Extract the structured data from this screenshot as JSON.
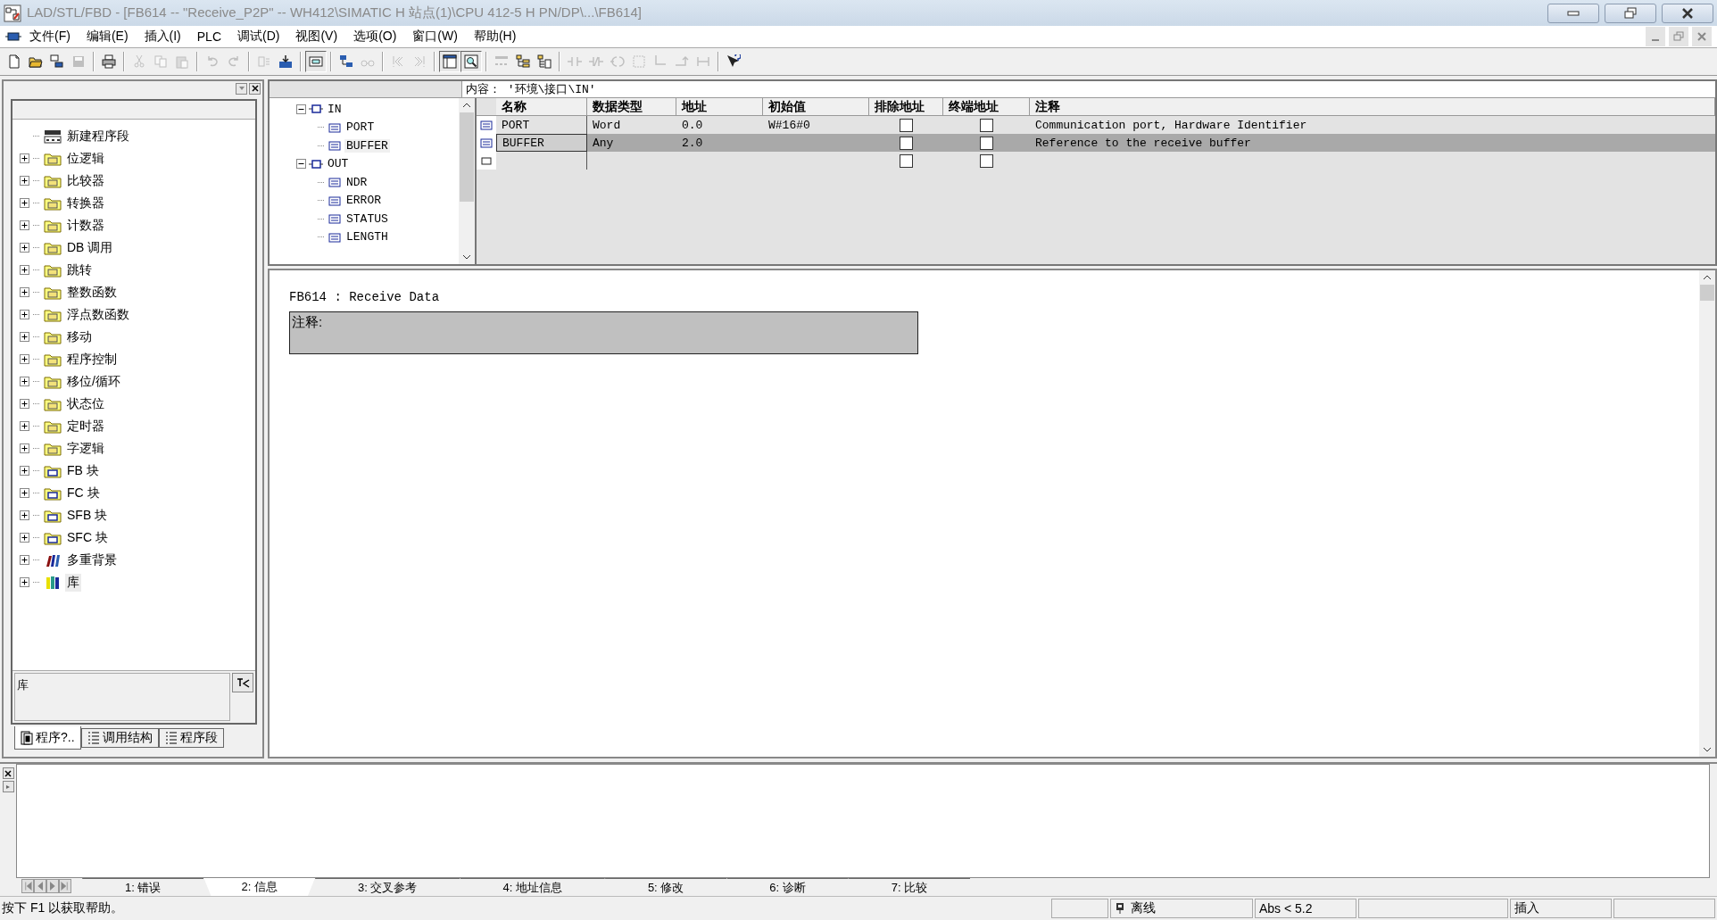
{
  "window": {
    "title": "LAD/STL/FBD  - [FB614 -- \"Receive_P2P\" -- WH412\\SIMATIC H 站点(1)\\CPU 412-5 H PN/DP\\...\\FB614]",
    "active": false
  },
  "menu": [
    "文件(F)",
    "编辑(E)",
    "插入(I)",
    "PLC",
    "调试(D)",
    "视图(V)",
    "选项(O)",
    "窗口(W)",
    "帮助(H)"
  ],
  "toolbar": [
    [
      {
        "pressed": false,
        "disabled": false
      },
      {
        "pressed": false,
        "disabled": false
      },
      {
        "pressed": false,
        "disabled": false
      },
      {
        "pressed": false,
        "disabled": true
      }
    ],
    [
      {
        "pressed": false,
        "disabled": false
      }
    ],
    [
      {
        "pressed": false,
        "disabled": true
      },
      {
        "pressed": false,
        "disabled": true
      },
      {
        "pressed": false,
        "disabled": true
      }
    ],
    [
      {
        "pressed": false,
        "disabled": true
      },
      {
        "pressed": false,
        "disabled": true
      }
    ],
    [
      {
        "pressed": false,
        "disabled": true
      },
      {
        "pressed": false,
        "disabled": false
      }
    ],
    [
      {
        "pressed": true,
        "disabled": false
      }
    ],
    [
      {
        "pressed": false,
        "disabled": false
      },
      {
        "pressed": false,
        "disabled": true
      }
    ],
    [
      {
        "pressed": false,
        "disabled": true
      },
      {
        "pressed": false,
        "disabled": true
      }
    ],
    [
      {
        "pressed": true,
        "disabled": false
      },
      {
        "pressed": true,
        "disabled": false
      }
    ],
    [
      {
        "pressed": false,
        "disabled": true
      },
      {
        "pressed": false,
        "disabled": false
      },
      {
        "pressed": false,
        "disabled": false
      }
    ],
    [
      {
        "pressed": false,
        "disabled": true
      },
      {
        "pressed": false,
        "disabled": true
      },
      {
        "pressed": false,
        "disabled": true
      },
      {
        "pressed": false,
        "disabled": true
      },
      {
        "pressed": false,
        "disabled": true
      },
      {
        "pressed": false,
        "disabled": true
      },
      {
        "pressed": false,
        "disabled": true
      }
    ],
    [
      {
        "pressed": false,
        "disabled": false
      }
    ]
  ],
  "elements_panel": {
    "tree": [
      {
        "label": "新建程序段",
        "kind": "network"
      },
      {
        "label": "位逻辑",
        "kind": "folder",
        "expanded": false
      },
      {
        "label": "比较器",
        "kind": "folder",
        "expanded": false
      },
      {
        "label": "转换器",
        "kind": "folder",
        "expanded": false
      },
      {
        "label": "计数器",
        "kind": "folder",
        "expanded": false
      },
      {
        "label": "DB 调用",
        "kind": "folder",
        "expanded": false
      },
      {
        "label": "跳转",
        "kind": "folder",
        "expanded": false
      },
      {
        "label": "整数函数",
        "kind": "folder",
        "expanded": false
      },
      {
        "label": "浮点数函数",
        "kind": "folder",
        "expanded": false
      },
      {
        "label": "移动",
        "kind": "folder",
        "expanded": false
      },
      {
        "label": "程序控制",
        "kind": "folder",
        "expanded": false
      },
      {
        "label": "移位/循环",
        "kind": "folder",
        "expanded": false
      },
      {
        "label": "状态位",
        "kind": "folder",
        "expanded": false
      },
      {
        "label": "定时器",
        "kind": "folder",
        "expanded": false
      },
      {
        "label": "字逻辑",
        "kind": "folder",
        "expanded": false
      },
      {
        "label": "FB 块",
        "kind": "block",
        "expanded": false
      },
      {
        "label": "FC 块",
        "kind": "block",
        "expanded": false
      },
      {
        "label": "SFB 块",
        "kind": "block",
        "expanded": false
      },
      {
        "label": "SFC 块",
        "kind": "block",
        "expanded": false
      },
      {
        "label": "多重背景",
        "kind": "multi",
        "expanded": false
      },
      {
        "label": "库",
        "kind": "library",
        "expanded": false,
        "selected": true
      }
    ],
    "info": "库",
    "tabs": [
      {
        "label": "程序?..",
        "selected": true
      },
      {
        "label": "调用结构",
        "selected": false
      },
      {
        "label": "程序段",
        "selected": false
      }
    ]
  },
  "interface": {
    "content_path": "内容：  '环境\\接口\\IN'",
    "tree": [
      {
        "label": "IN",
        "expanded": true,
        "children": [
          {
            "label": "PORT",
            "selected": false
          },
          {
            "label": "BUFFER",
            "selected": true
          }
        ]
      },
      {
        "label": "OUT",
        "expanded": true,
        "children": [
          {
            "label": "NDR",
            "selected": false
          },
          {
            "label": "ERROR",
            "selected": false
          },
          {
            "label": "STATUS",
            "selected": false
          },
          {
            "label": "LENGTH",
            "selected": false
          }
        ]
      }
    ],
    "columns": [
      "名称",
      "数据类型",
      "地址",
      "初始值",
      "排除地址",
      "终端地址",
      "注释"
    ],
    "rows": [
      {
        "kind": "param",
        "name": "PORT",
        "type": "Word",
        "address": "0.0",
        "initial": "W#16#0",
        "exclude": false,
        "terminal": false,
        "comment": "Communication port, Hardware Identifier",
        "selected": false
      },
      {
        "kind": "param",
        "name": "BUFFER",
        "type": "Any",
        "address": "2.0",
        "exclude": false,
        "terminal": false,
        "comment": "Reference to the receive buffer",
        "selected": true
      },
      {
        "kind": "new",
        "exclude": false,
        "terminal": false,
        "selected": false
      }
    ]
  },
  "code": {
    "block_title": "FB614 : Receive Data",
    "comment_label": "注释:"
  },
  "output": {
    "tabs": [
      {
        "label": "1: 错误",
        "selected": false
      },
      {
        "label": "2: 信息",
        "selected": true
      },
      {
        "label": "3: 交叉参考",
        "selected": false
      },
      {
        "label": "4: 地址信息",
        "selected": false
      },
      {
        "label": "5: 修改",
        "selected": false
      },
      {
        "label": "6: 诊断",
        "selected": false
      },
      {
        "label": "7: 比较",
        "selected": false
      }
    ]
  },
  "status_bar": {
    "help": "按下 F1 以获取帮助。",
    "mode": "离线",
    "version": "Abs < 5.2",
    "insert": "插入"
  }
}
